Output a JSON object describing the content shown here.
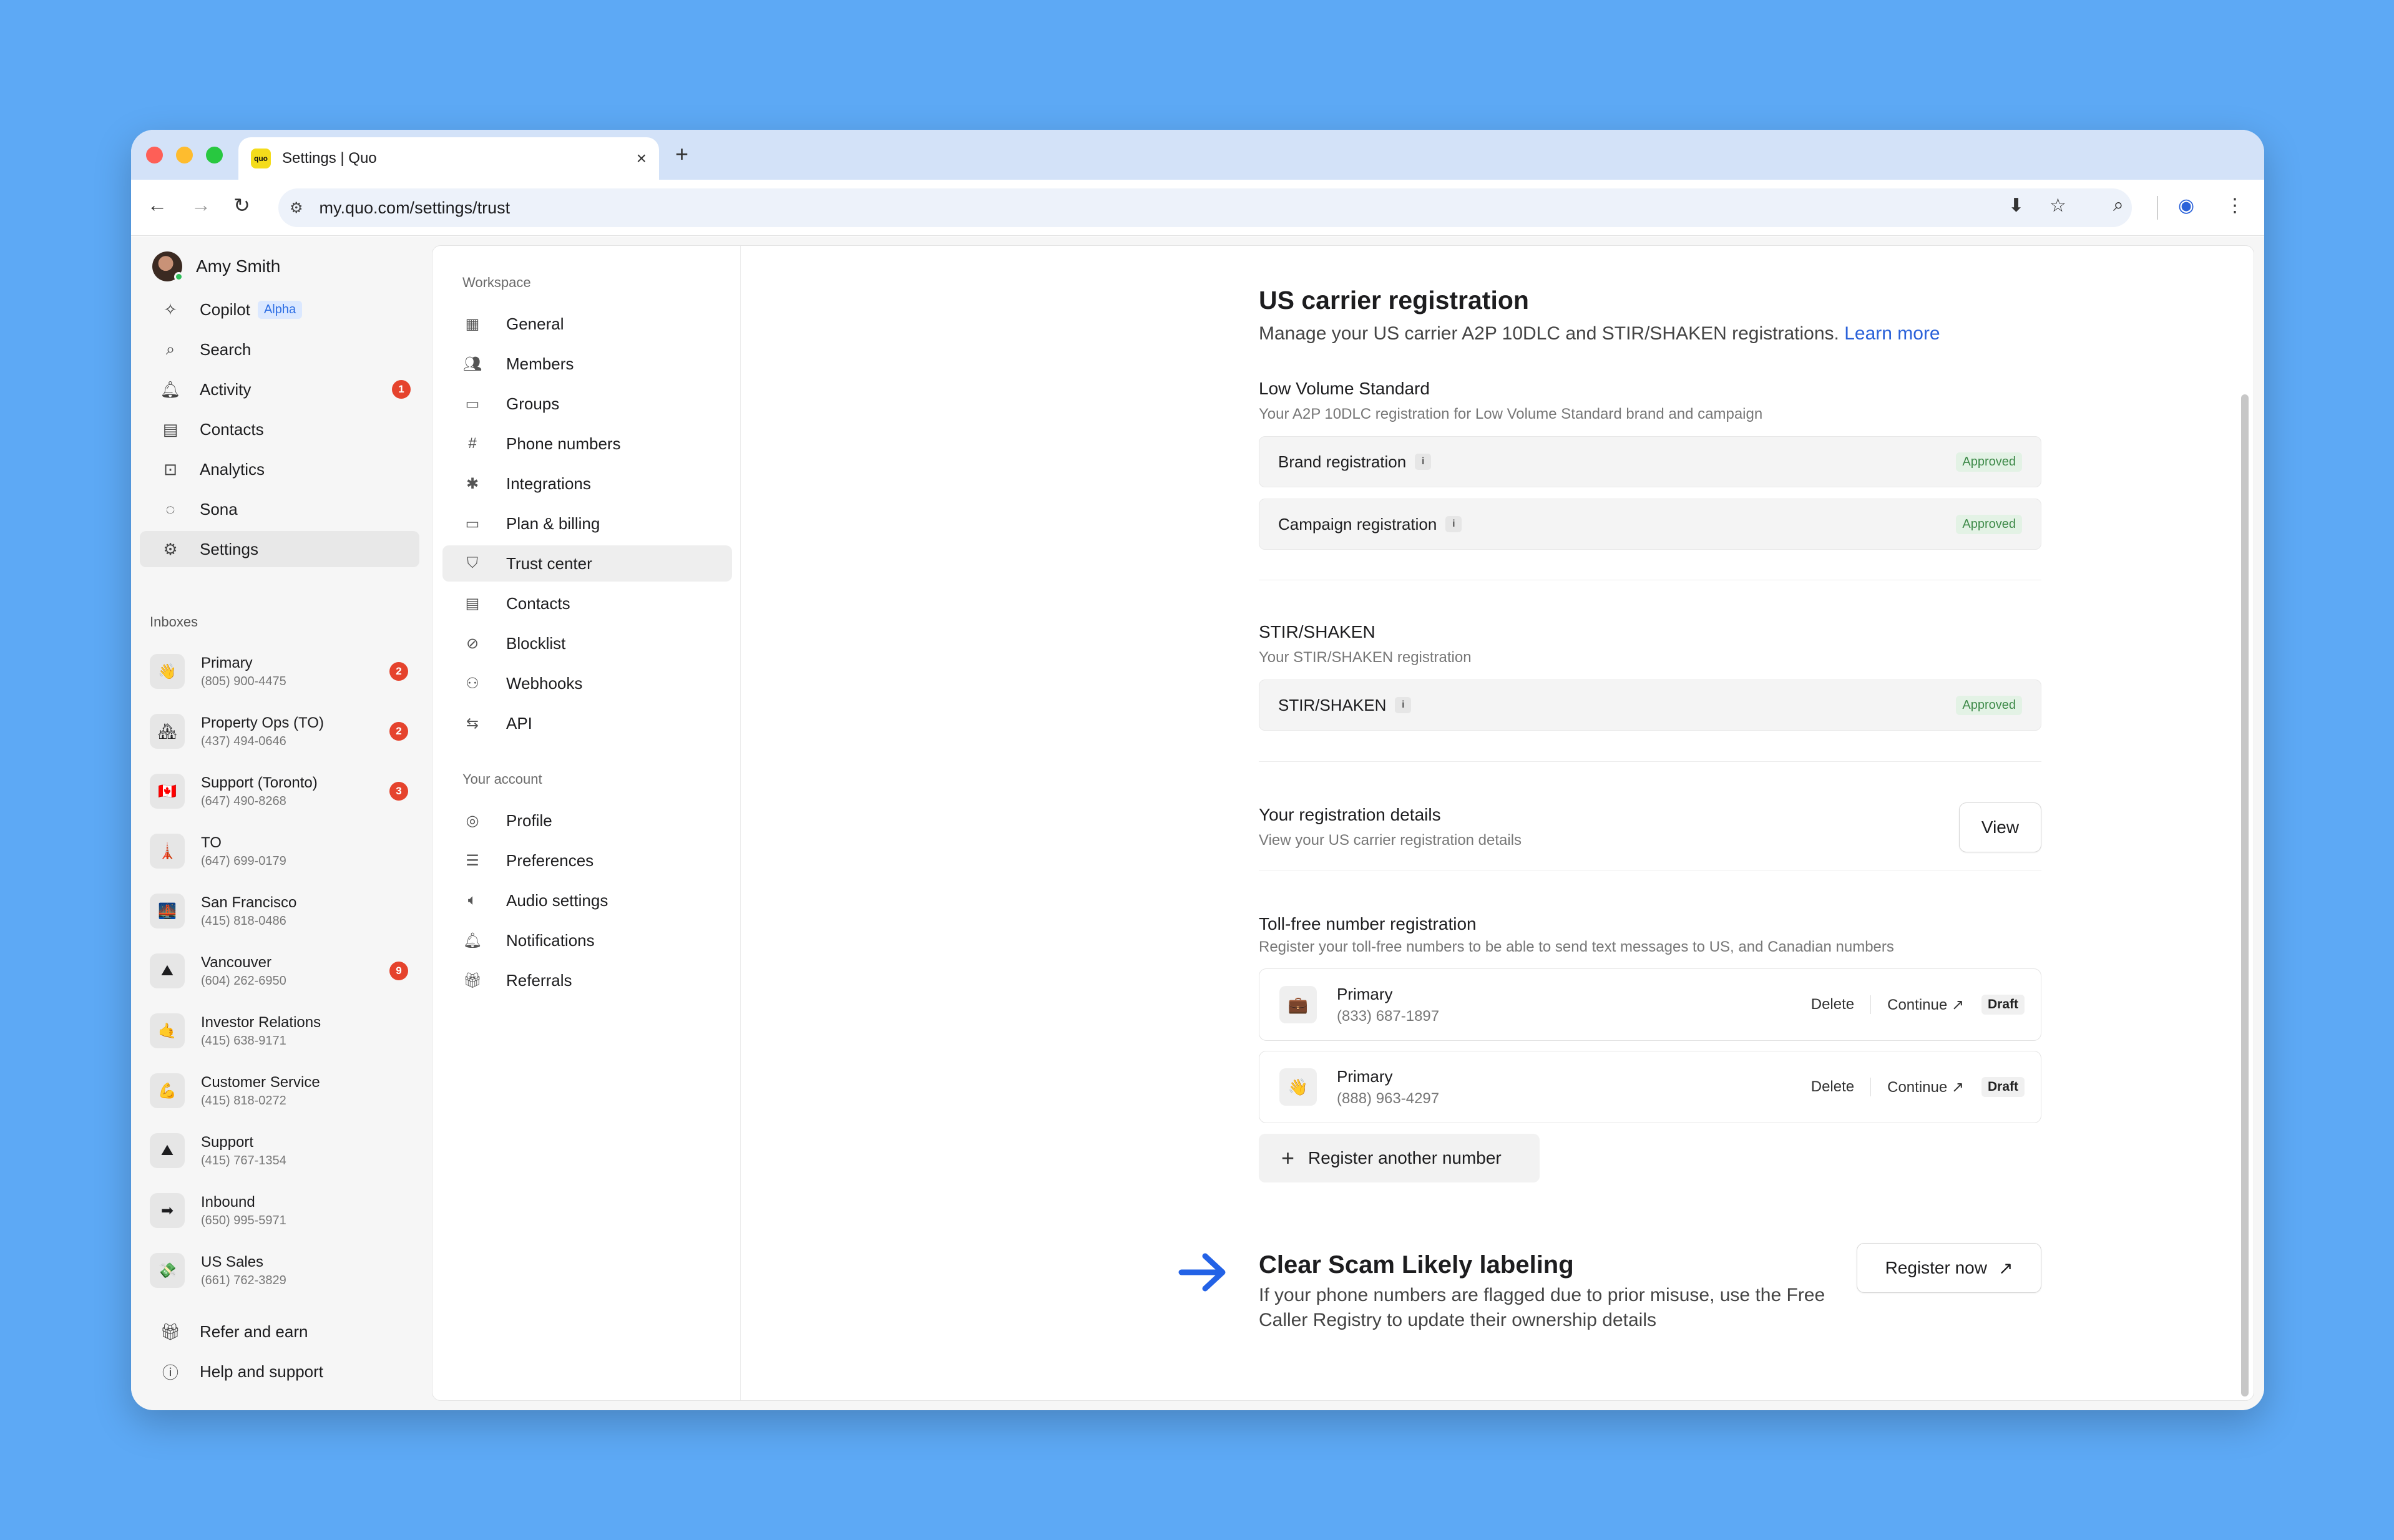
{
  "browser": {
    "tab_title": "Settings | Quo",
    "favicon_text": "quo",
    "url": "my.quo.com/settings/trust",
    "new_tab": "+",
    "close_tab": "×"
  },
  "sidebar": {
    "user_name": "Amy Smith",
    "nav": [
      {
        "label": "Copilot",
        "badge": "Alpha",
        "icon": "sparkle-icon"
      },
      {
        "label": "Search",
        "icon": "search-icon"
      },
      {
        "label": "Activity",
        "count": "1",
        "icon": "bell-icon"
      },
      {
        "label": "Contacts",
        "icon": "contacts-icon"
      },
      {
        "label": "Analytics",
        "icon": "analytics-icon"
      },
      {
        "label": "Sona",
        "icon": "sona-icon"
      },
      {
        "label": "Settings",
        "icon": "gear-icon",
        "active": true
      }
    ],
    "inboxes_label": "Inboxes",
    "inboxes": [
      {
        "name": "Primary",
        "number": "(805) 900-4475",
        "emoji": "👋",
        "count": "2"
      },
      {
        "name": "Property Ops (TO)",
        "number": "(437) 494-0646",
        "emoji": "🏘",
        "count": "2"
      },
      {
        "name": "Support (Toronto)",
        "number": "(647) 490-8268",
        "emoji": "🇨🇦",
        "count": "3"
      },
      {
        "name": "TO",
        "number": "(647) 699-0179",
        "emoji": "🗼",
        "count": ""
      },
      {
        "name": "San Francisco",
        "number": "(415) 818-0486",
        "emoji": "🌉",
        "count": ""
      },
      {
        "name": "Vancouver",
        "number": "(604) 262-6950",
        "emoji": "⛰",
        "count": "9"
      },
      {
        "name": "Investor Relations",
        "number": "(415) 638-9171",
        "emoji": "🤙",
        "count": ""
      },
      {
        "name": "Customer Service",
        "number": "(415) 818-0272",
        "emoji": "💪",
        "count": ""
      },
      {
        "name": "Support",
        "number": "(415) 767-1354",
        "emoji": "⛰",
        "count": ""
      },
      {
        "name": "Inbound",
        "number": "(650) 995-5971",
        "emoji": "➡",
        "count": ""
      },
      {
        "name": "US Sales",
        "number": "(661) 762-3829",
        "emoji": "💸",
        "count": ""
      }
    ],
    "footer": [
      {
        "label": "Refer and earn",
        "icon": "gift-icon"
      },
      {
        "label": "Help and support",
        "icon": "help-icon"
      }
    ]
  },
  "settings_nav": {
    "workspace_label": "Workspace",
    "workspace": [
      {
        "label": "General",
        "icon": "building-icon"
      },
      {
        "label": "Members",
        "icon": "members-icon"
      },
      {
        "label": "Groups",
        "icon": "folder-icon"
      },
      {
        "label": "Phone numbers",
        "icon": "hash-icon"
      },
      {
        "label": "Integrations",
        "icon": "integrations-icon"
      },
      {
        "label": "Plan & billing",
        "icon": "card-icon"
      },
      {
        "label": "Trust center",
        "icon": "shield-icon",
        "active": true
      },
      {
        "label": "Contacts",
        "icon": "contacts-icon"
      },
      {
        "label": "Blocklist",
        "icon": "block-icon"
      },
      {
        "label": "Webhooks",
        "icon": "webhook-icon"
      },
      {
        "label": "API",
        "icon": "api-icon"
      }
    ],
    "account_label": "Your account",
    "account": [
      {
        "label": "Profile",
        "icon": "profile-icon"
      },
      {
        "label": "Preferences",
        "icon": "sliders-icon"
      },
      {
        "label": "Audio settings",
        "icon": "speaker-icon"
      },
      {
        "label": "Notifications",
        "icon": "bell-icon"
      },
      {
        "label": "Referrals",
        "icon": "gift-icon"
      }
    ]
  },
  "main": {
    "title": "US carrier registration",
    "subtitle": "Manage your US carrier A2P 10DLC and STIR/SHAKEN registrations.",
    "learn_more": "Learn more",
    "lvs_title": "Low Volume Standard",
    "lvs_desc": "Your A2P 10DLC registration for Low Volume Standard brand and campaign",
    "brand_label": "Brand registration",
    "campaign_label": "Campaign registration",
    "approved": "Approved",
    "stir_title": "STIR/SHAKEN",
    "stir_desc": "Your STIR/SHAKEN registration",
    "stir_row": "STIR/SHAKEN",
    "details_title": "Your registration details",
    "details_desc": "View your US carrier registration details",
    "view_btn": "View",
    "tf_title": "Toll-free number registration",
    "tf_desc": "Register your toll-free numbers to be able to send text messages to US, and Canadian numbers",
    "tf_rows": [
      {
        "name": "Primary",
        "number": "(833) 687-1897",
        "emoji": "💼"
      },
      {
        "name": "Primary",
        "number": "(888) 963-4297",
        "emoji": "👋"
      }
    ],
    "delete": "Delete",
    "continue": "Continue",
    "draft": "Draft",
    "register_another": "Register another number",
    "scam_title": "Clear Scam Likely labeling",
    "scam_desc": "If your phone numbers are flagged due to prior misuse, use the Free Caller Registry to update their ownership details",
    "register_now": "Register now"
  }
}
